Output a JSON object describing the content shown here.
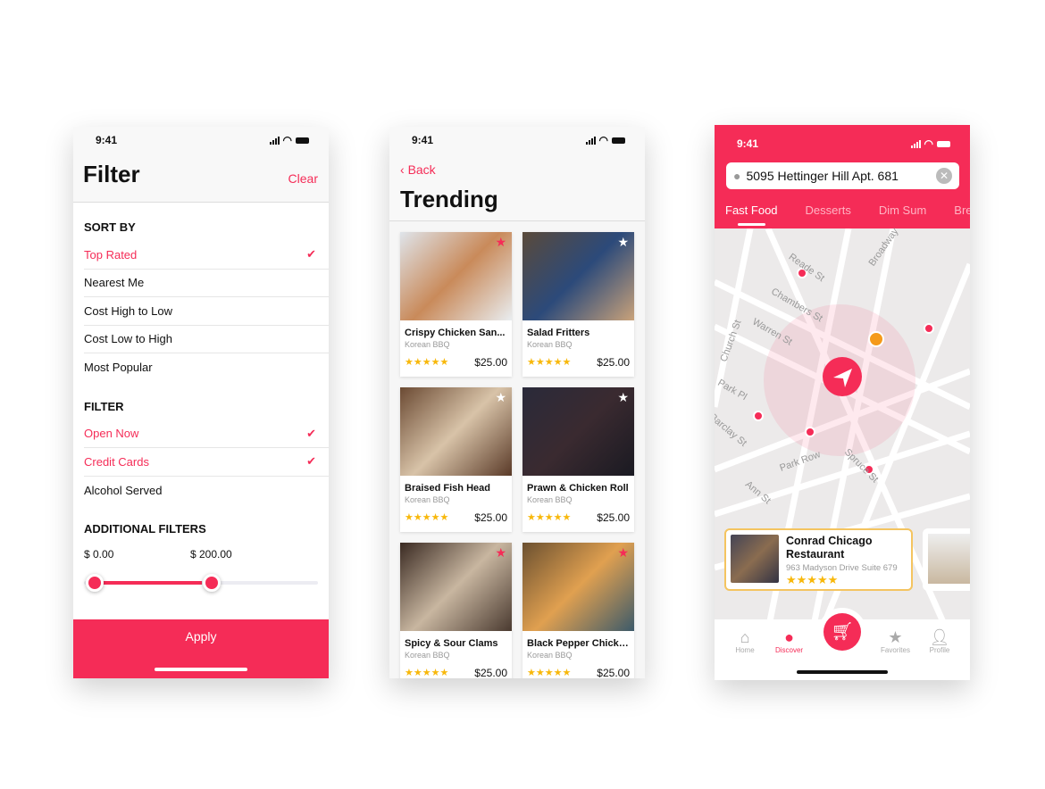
{
  "status_time": "9:41",
  "filter": {
    "title": "Filter",
    "clear": "Clear",
    "sort_title": "SORT BY",
    "sort_items": [
      {
        "label": "Top Rated",
        "selected": true
      },
      {
        "label": "Nearest Me",
        "selected": false
      },
      {
        "label": "Cost High to Low",
        "selected": false
      },
      {
        "label": "Cost Low to High",
        "selected": false
      },
      {
        "label": "Most Popular",
        "selected": false
      }
    ],
    "filter_title": "FILTER",
    "filter_items": [
      {
        "label": "Open Now",
        "selected": true
      },
      {
        "label": "Credit Cards",
        "selected": true
      },
      {
        "label": "Alcohol Served",
        "selected": false
      }
    ],
    "additional_title": "ADDITIONAL FILTERS",
    "price_min": "$ 0.00",
    "price_max": "$ 200.00",
    "apply": "Apply"
  },
  "trending": {
    "back": "Back",
    "title": "Trending",
    "items": [
      {
        "name": "Crispy Chicken San...",
        "category": "Korean BBQ",
        "price": "$25.00",
        "rating": 5,
        "favorite": true
      },
      {
        "name": "Salad Fritters",
        "category": "Korean BBQ",
        "price": "$25.00",
        "rating": 5,
        "favorite": false
      },
      {
        "name": "Braised Fish Head",
        "category": "Korean BBQ",
        "price": "$25.00",
        "rating": 5,
        "favorite": false
      },
      {
        "name": "Prawn & Chicken Roll",
        "category": "Korean BBQ",
        "price": "$25.00",
        "rating": 5,
        "favorite": false
      },
      {
        "name": "Spicy & Sour Clams",
        "category": "Korean BBQ",
        "price": "$25.00",
        "rating": 5,
        "favorite": true
      },
      {
        "name": "Black Pepper Chicken",
        "category": "Korean BBQ",
        "price": "$25.00",
        "rating": 5,
        "favorite": true
      }
    ]
  },
  "discover": {
    "search_value": "5095 Hettinger Hill Apt. 681",
    "tabs": [
      "Fast Food",
      "Desserts",
      "Dim Sum",
      "Breakfast"
    ],
    "streets": [
      "Reade St",
      "Chambers St",
      "Warren St",
      "Church St",
      "Broadway",
      "Park Pl",
      "Barclay St",
      "Park Row",
      "Spruce St",
      "Ann St"
    ],
    "card": {
      "name": "Conrad Chicago Restaurant",
      "address": "963 Madyson Drive Suite 679",
      "rating": 5
    },
    "nav": [
      "Home",
      "Discover",
      "Favorites",
      "Profile"
    ]
  },
  "colors": {
    "accent": "#f52c57",
    "star": "#f8b80b"
  }
}
